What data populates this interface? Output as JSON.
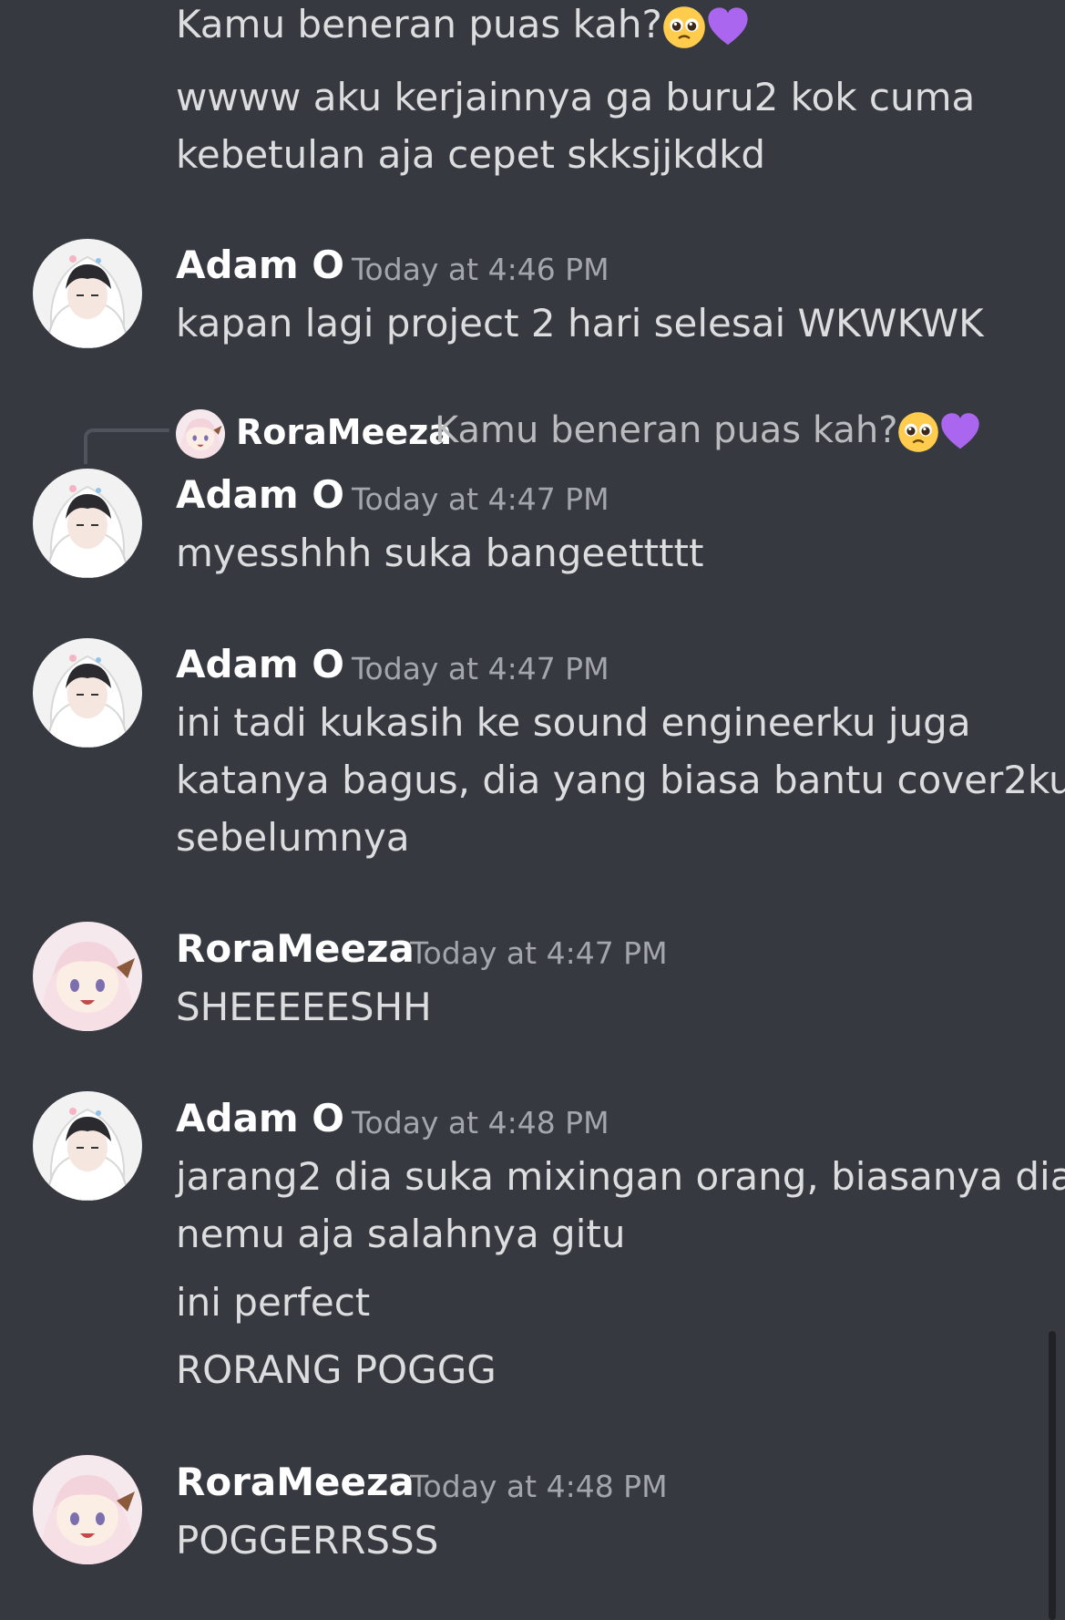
{
  "messages": {
    "m0_line1": "Kamu beneran puas kah?",
    "m0_line2": "wwww aku kerjainnya ga buru2 kok cuma",
    "m0_line3": "kebetulan aja cepet skksjjkdkd",
    "m1_name": "Adam O",
    "m1_time": "Today at 4:46 PM",
    "m1_line1": "kapan lagi project 2 hari selesai WKWKWK",
    "reply_name": "RoraMeeza",
    "reply_text": "Kamu beneran puas kah?",
    "m2_name": "Adam O",
    "m2_time": "Today at 4:47 PM",
    "m2_line1": "myesshhh suka bangeettttt",
    "m3_name": "Adam O",
    "m3_time": "Today at 4:47 PM",
    "m3_line1": "ini tadi kukasih ke sound engineerku juga",
    "m3_line2": "katanya bagus, dia yang biasa bantu cover2ku",
    "m3_line3": "sebelumnya",
    "m4_name": "RoraMeeza",
    "m4_time": "Today at 4:47 PM",
    "m4_line1": "SHEEEEESHH",
    "m5_name": "Adam O",
    "m5_time": "Today at 4:48 PM",
    "m5_line1": "jarang2 dia suka mixingan orang, biasanya dia",
    "m5_line2": "nemu aja salahnya gitu",
    "m5_line3": "ini perfect",
    "m5_line4": "RORANG POGGG",
    "m6_name": "RoraMeeza",
    "m6_time": "Today at 4:48 PM",
    "m6_line1": "POGGERRSSS"
  },
  "emojis": [
    "pleading-face-emoji",
    "purple-heart-emoji"
  ]
}
